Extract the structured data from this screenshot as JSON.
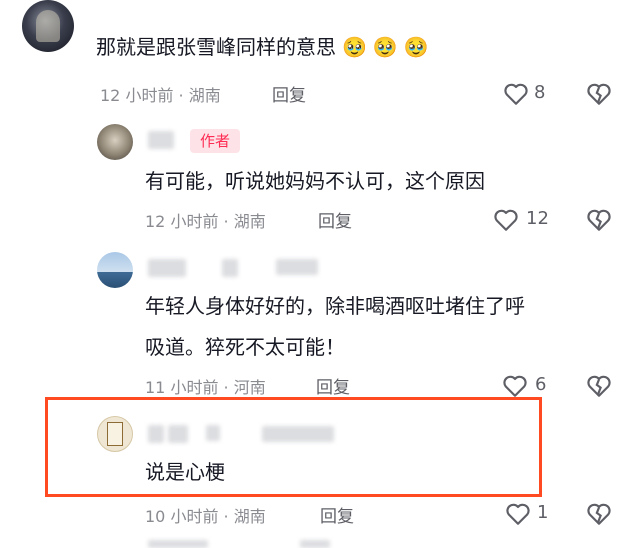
{
  "comments": [
    {
      "text": "那就是跟张雪峰同样的意思",
      "emojis": [
        "🥹",
        "🥹",
        "🥹"
      ],
      "time": "12 小时前 · 湖南",
      "reply_label": "回复",
      "likes": "8"
    },
    {
      "badge": "作者",
      "text": "有可能，听说她妈妈不认可，这个原因",
      "time": "12 小时前 · 湖南",
      "reply_label": "回复",
      "likes": "12"
    },
    {
      "text_line1": "年轻人身体好好的，除非喝酒呕吐堵住了呼",
      "text_line2": "吸道。猝死不太可能！",
      "time": "11 小时前 · 河南",
      "reply_label": "回复",
      "likes": "6"
    },
    {
      "text": "说是心梗",
      "time": "10 小时前 · 湖南",
      "reply_label": "回复",
      "likes": "1"
    }
  ],
  "icons": {
    "like": "heart-outline-icon",
    "dislike": "broken-heart-icon"
  },
  "colors": {
    "badge_text": "#fe2c55",
    "badge_bg": "#fde3e7",
    "highlight_border": "#ff4a22",
    "meta_text": "#8a8b91"
  }
}
